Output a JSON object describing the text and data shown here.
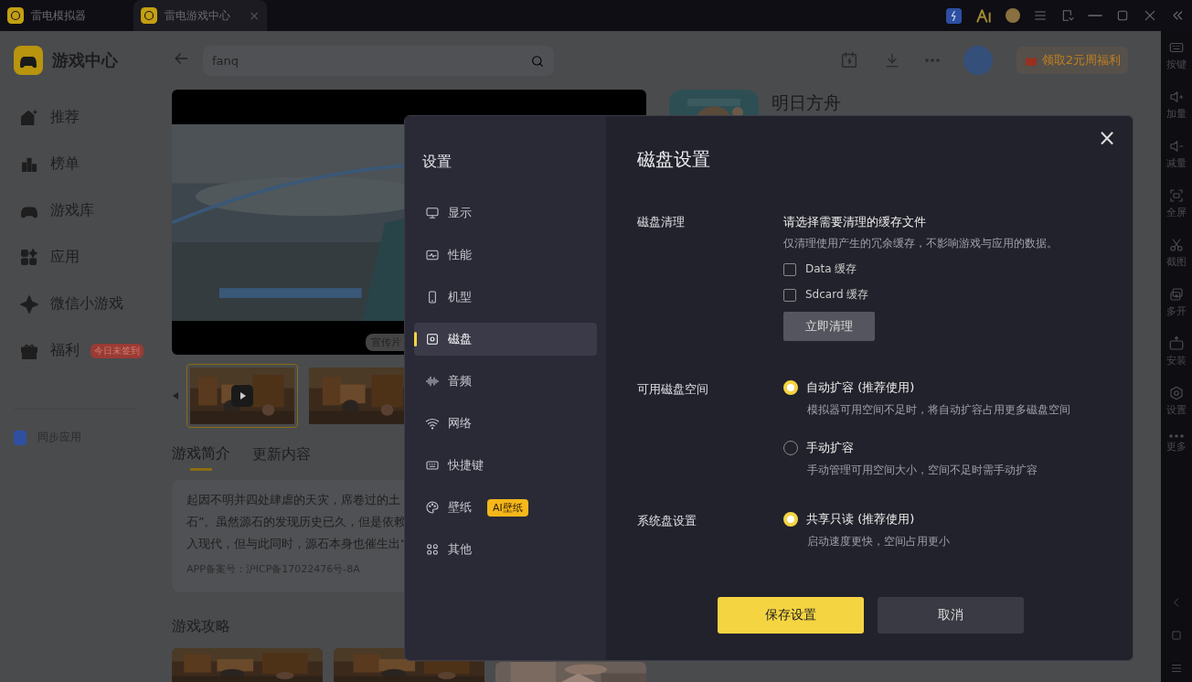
{
  "title_bar": {
    "tabs": [
      {
        "label": "雷电模拟器",
        "selected": false
      },
      {
        "label": "雷电游戏中心",
        "selected": true,
        "close": "×"
      }
    ]
  },
  "sidebar": {
    "title": "游戏中心",
    "items": [
      {
        "label": "推荐"
      },
      {
        "label": "榜单"
      },
      {
        "label": "游戏库"
      },
      {
        "label": "应用"
      },
      {
        "label": "微信小游戏"
      },
      {
        "label": "福利",
        "badge": "今日未签到"
      }
    ],
    "sync": "同步应用"
  },
  "header": {
    "search": {
      "value": "fanq"
    },
    "promo": "领取2元周福利"
  },
  "game": {
    "title": "明日方舟",
    "video_tag": "宣传片",
    "thumbnails": [
      {
        "selected": true
      },
      {
        "selected": false
      }
    ],
    "tabs": [
      {
        "label": "游戏简介",
        "selected": true
      },
      {
        "label": "更新内容",
        "selected": false
      }
    ],
    "description": [
      "起因不明并四处肆虐的天灾，席卷过的土",
      "石”。虽然源石的发现历史已久，但是依赖",
      "入现代，但与此同时，源石本身也催生出“"
    ],
    "record": "APP备案号：沪ICP备17022476号-8A",
    "guides_title": "游戏攻略"
  },
  "toolbar": [
    {
      "label": "按键"
    },
    {
      "label": "加量"
    },
    {
      "label": "减量"
    },
    {
      "label": "全屏"
    },
    {
      "label": "截图"
    },
    {
      "label": "多开"
    },
    {
      "label": "安装"
    },
    {
      "label": "设置"
    },
    {
      "label": "更多"
    }
  ],
  "settings": {
    "title": "设置",
    "nav": [
      {
        "label": "显示",
        "selected": false
      },
      {
        "label": "性能",
        "selected": false
      },
      {
        "label": "机型",
        "selected": false
      },
      {
        "label": "磁盘",
        "selected": true
      },
      {
        "label": "音频",
        "selected": false
      },
      {
        "label": "网络",
        "selected": false
      },
      {
        "label": "快捷键",
        "selected": false
      },
      {
        "label": "壁纸",
        "selected": false,
        "badge": "AI壁纸"
      },
      {
        "label": "其他",
        "selected": false
      }
    ],
    "heading": "磁盘设置",
    "sections": [
      {
        "kind": "checks",
        "label": "磁盘清理",
        "prompt": "请选择需要清理的缓存文件",
        "hint": "仅清理使用产生的冗余缓存，不影响游戏与应用的数据。",
        "options": [
          {
            "label": "Data 缓存",
            "checked": false
          },
          {
            "label": "Sdcard 缓存",
            "checked": false
          }
        ],
        "button": "立即清理"
      },
      {
        "kind": "radios",
        "label": "可用磁盘空间",
        "options": [
          {
            "label": "自动扩容 (推荐使用)",
            "hint": "模拟器可用空间不足时，将自动扩容占用更多磁盘空间",
            "selected": true
          },
          {
            "label": "手动扩容",
            "hint": "手动管理可用空间大小，空间不足时需手动扩容",
            "selected": false
          }
        ]
      },
      {
        "kind": "radios",
        "label": "系统盘设置",
        "options": [
          {
            "label": "共享只读 (推荐使用)",
            "hint": "启动速度更快，空间占用更小",
            "selected": true
          }
        ]
      }
    ],
    "save": "保存设置",
    "cancel": "取消",
    "close": "×"
  }
}
